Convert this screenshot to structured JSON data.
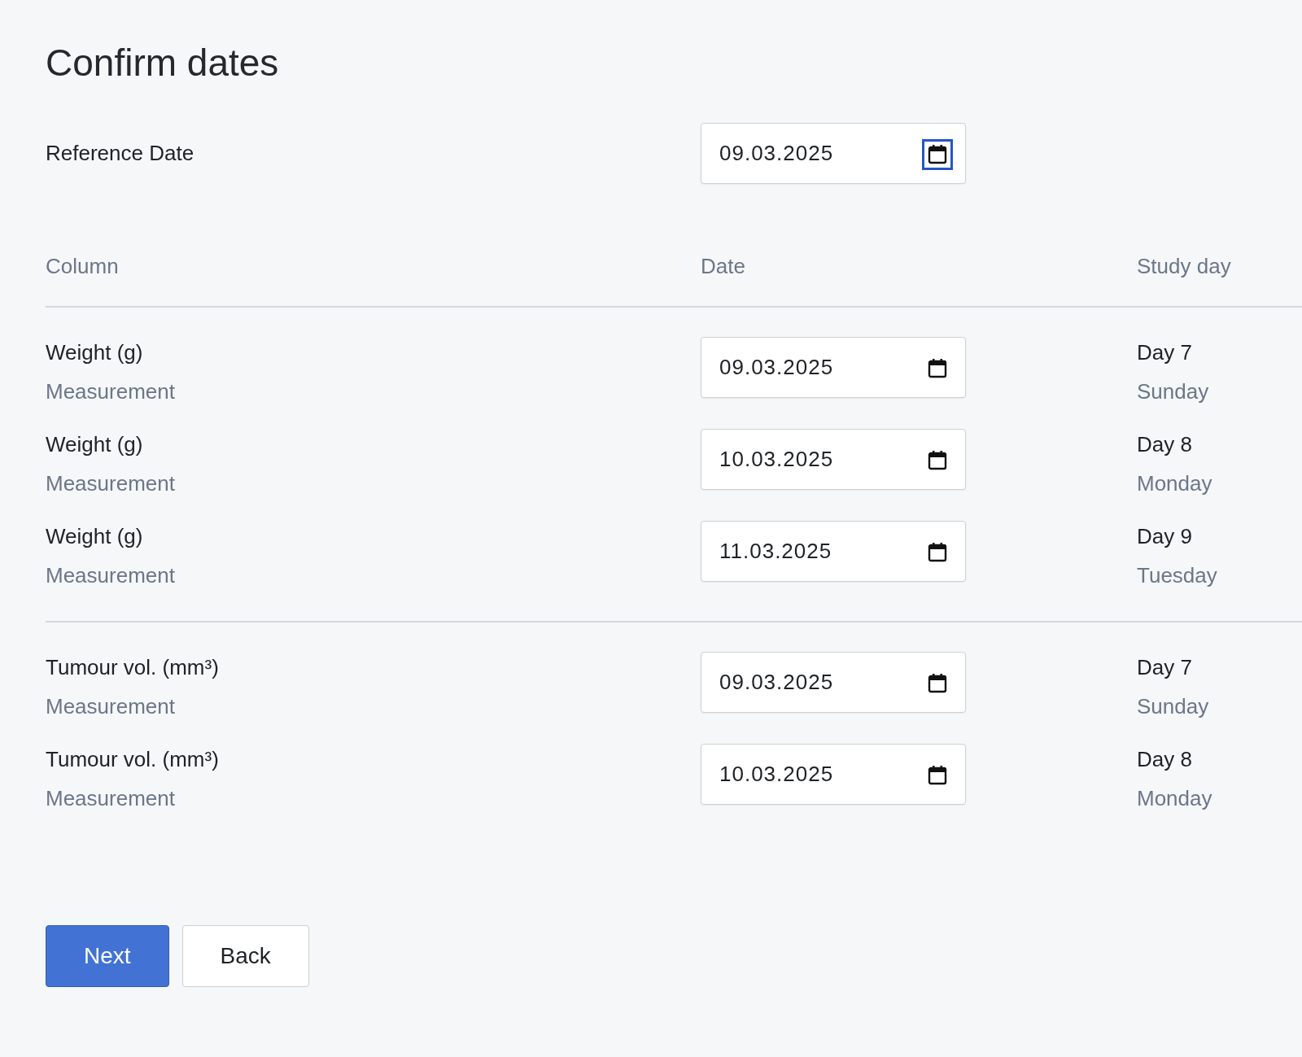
{
  "title": "Confirm dates",
  "reference_date": {
    "label": "Reference Date",
    "value": "09.03.2025",
    "focused": true
  },
  "table": {
    "columns": [
      "Column",
      "Date",
      "Study day"
    ],
    "groups": [
      {
        "rows": [
          {
            "name": "Weight (g)",
            "type": "Measurement",
            "date": "09.03.2025",
            "day": "Day 7",
            "weekday": "Sunday"
          },
          {
            "name": "Weight (g)",
            "type": "Measurement",
            "date": "10.03.2025",
            "day": "Day 8",
            "weekday": "Monday"
          },
          {
            "name": "Weight (g)",
            "type": "Measurement",
            "date": "11.03.2025",
            "day": "Day 9",
            "weekday": "Tuesday"
          }
        ]
      },
      {
        "rows": [
          {
            "name": "Tumour vol. (mm³)",
            "type": "Measurement",
            "date": "09.03.2025",
            "day": "Day 7",
            "weekday": "Sunday"
          },
          {
            "name": "Tumour vol. (mm³)",
            "type": "Measurement",
            "date": "10.03.2025",
            "day": "Day 8",
            "weekday": "Monday"
          }
        ]
      }
    ]
  },
  "buttons": [
    {
      "label": "Next",
      "kind": "primary"
    },
    {
      "label": "Back",
      "kind": "secondary"
    }
  ]
}
